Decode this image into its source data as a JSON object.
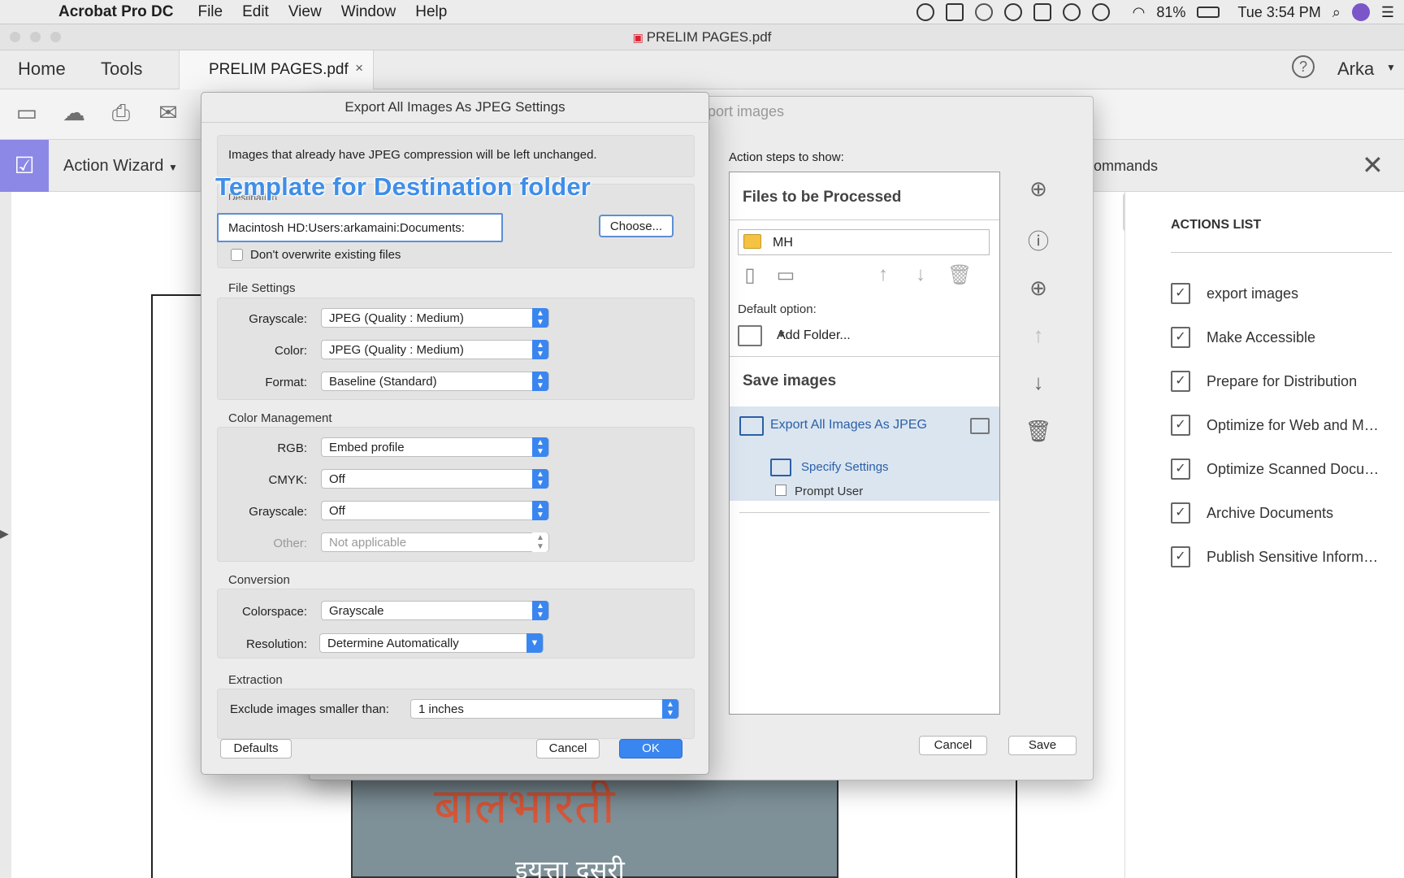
{
  "menubar": {
    "app_name": "Acrobat Pro DC",
    "items": [
      "File",
      "Edit",
      "View",
      "Window",
      "Help"
    ],
    "battery": "81%",
    "clock": "Tue 3:54 PM"
  },
  "window": {
    "title": "PRELIM PAGES.pdf"
  },
  "apptabs": {
    "home": "Home",
    "tools": "Tools",
    "doc_tab": "PRELIM PAGES.pdf",
    "close": "×",
    "user": "Arka",
    "help": "?"
  },
  "action_wizard": {
    "title": "Action Wizard",
    "commands_label": "ommands"
  },
  "document": {
    "cover_title": "बालभारती",
    "cover_sub": "इयत्ता दुसरी"
  },
  "actions_list": {
    "header": "ACTIONS LIST",
    "items": [
      "export images",
      "Make Accessible",
      "Prepare for Distribution",
      "Optimize for Web and M…",
      "Optimize Scanned Docu…",
      "Archive Documents",
      "Publish Sensitive Inform…"
    ]
  },
  "edit_action_dialog": {
    "title": "port images",
    "steps_label": "Action steps to show:",
    "files_section": "Files to be Processed",
    "folder_name": "MH",
    "default_option_label": "Default option:",
    "add_folder": "Add Folder...",
    "save_section": "Save images",
    "step_name": "Export All Images As JPEG",
    "specify_settings": "Specify Settings",
    "prompt_user": "Prompt User",
    "cancel": "Cancel",
    "save": "Save"
  },
  "jpeg_dialog": {
    "title": "Export All Images As JPEG Settings",
    "notice": "Images that already have JPEG compression will be left unchanged.",
    "destination_label": "Destination",
    "destination_path": "Macintosh HD:Users:arkamaini:Documents:",
    "choose": "Choose...",
    "dont_overwrite": "Don't overwrite existing files",
    "annotation": "Template for Destination folder",
    "file_settings": {
      "heading": "File Settings",
      "grayscale_label": "Grayscale:",
      "grayscale_value": "JPEG (Quality : Medium)",
      "color_label": "Color:",
      "color_value": "JPEG (Quality : Medium)",
      "format_label": "Format:",
      "format_value": "Baseline (Standard)"
    },
    "color_management": {
      "heading": "Color Management",
      "rgb_label": "RGB:",
      "rgb_value": "Embed profile",
      "cmyk_label": "CMYK:",
      "cmyk_value": "Off",
      "grayscale_label": "Grayscale:",
      "grayscale_value": "Off",
      "other_label": "Other:",
      "other_value": "Not applicable"
    },
    "conversion": {
      "heading": "Conversion",
      "colorspace_label": "Colorspace:",
      "colorspace_value": "Grayscale",
      "resolution_label": "Resolution:",
      "resolution_value": "Determine Automatically"
    },
    "extraction": {
      "heading": "Extraction",
      "exclude_label": "Exclude images smaller than:",
      "exclude_value": "1 inches"
    },
    "defaults": "Defaults",
    "cancel": "Cancel",
    "ok": "OK"
  }
}
